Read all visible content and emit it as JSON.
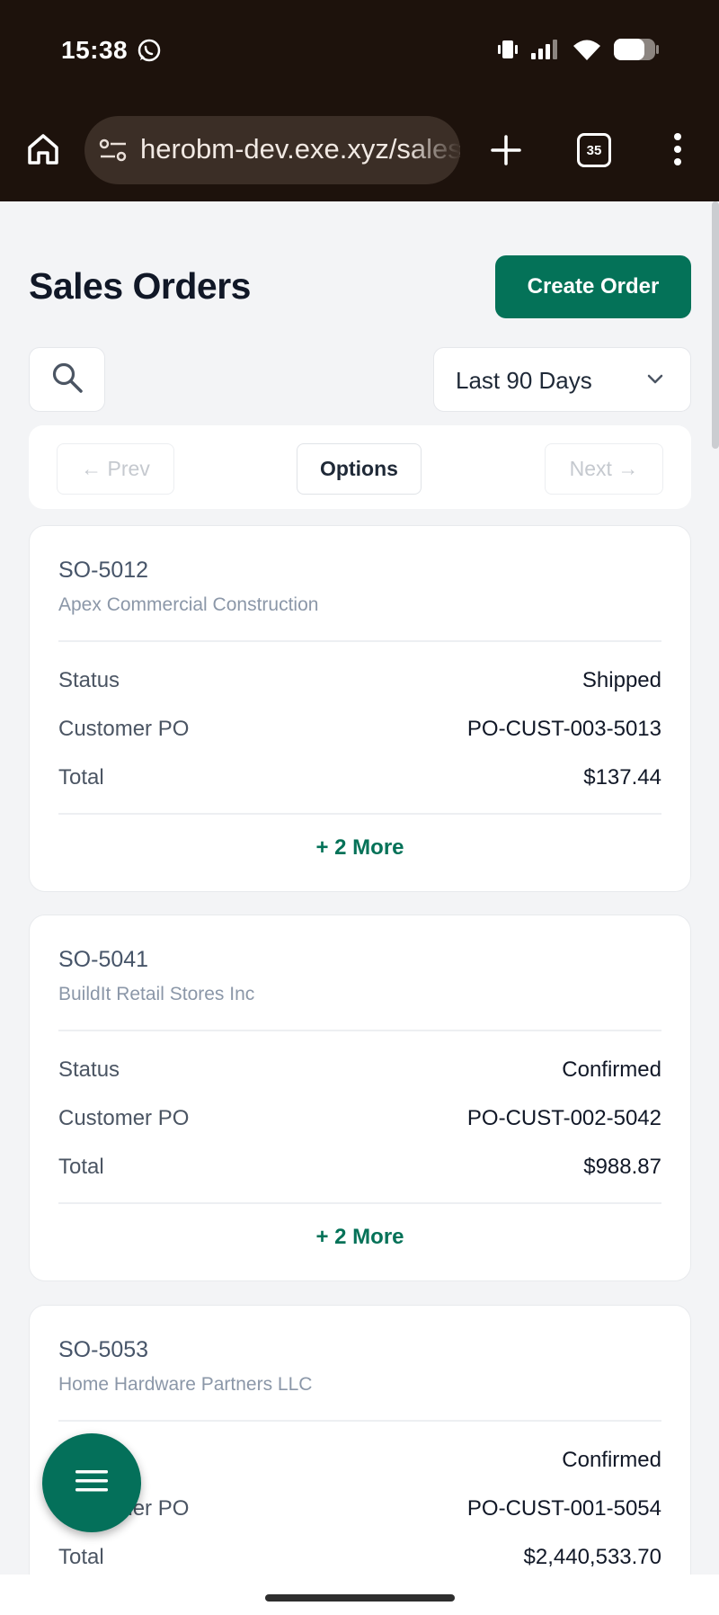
{
  "status_bar": {
    "time": "15:38"
  },
  "browser": {
    "url": "herobm-dev.exe.xyz/sales",
    "tab_count": "35"
  },
  "page": {
    "title": "Sales Orders",
    "create_button": "Create Order",
    "date_filter": "Last 90 Days",
    "pager": {
      "prev": "← Prev",
      "options": "Options",
      "next": "Next →"
    }
  },
  "field_labels": {
    "status": "Status",
    "customer_po": "Customer PO",
    "total": "Total"
  },
  "orders": [
    {
      "id": "SO-5012",
      "customer": "Apex Commercial Construction",
      "status": "Shipped",
      "customer_po": "PO-CUST-003-5013",
      "total": "$137.44",
      "more": "+ 2 More"
    },
    {
      "id": "SO-5041",
      "customer": "BuildIt Retail Stores Inc",
      "status": "Confirmed",
      "customer_po": "PO-CUST-002-5042",
      "total": "$988.87",
      "more": "+ 2 More"
    },
    {
      "id": "SO-5053",
      "customer": "Home Hardware Partners LLC",
      "status": "Confirmed",
      "customer_po": "PO-CUST-001-5054",
      "total": "$2,440,533.70"
    }
  ],
  "icons": {
    "whatsapp": "whatsapp-icon",
    "vibrate": "vibrate-icon",
    "signal": "signal-icon",
    "wifi": "wifi-icon",
    "battery": "battery-icon",
    "home": "home-icon",
    "site_settings": "tune-icon",
    "new_tab": "plus-icon",
    "menu": "more-vert-icon",
    "search": "search-icon",
    "chevron": "chevron-down-icon",
    "fab": "hamburger-menu-icon"
  },
  "colors": {
    "primary": "#047258",
    "browser_chrome": "#1d120c",
    "page_bg": "#f3f4f6"
  }
}
